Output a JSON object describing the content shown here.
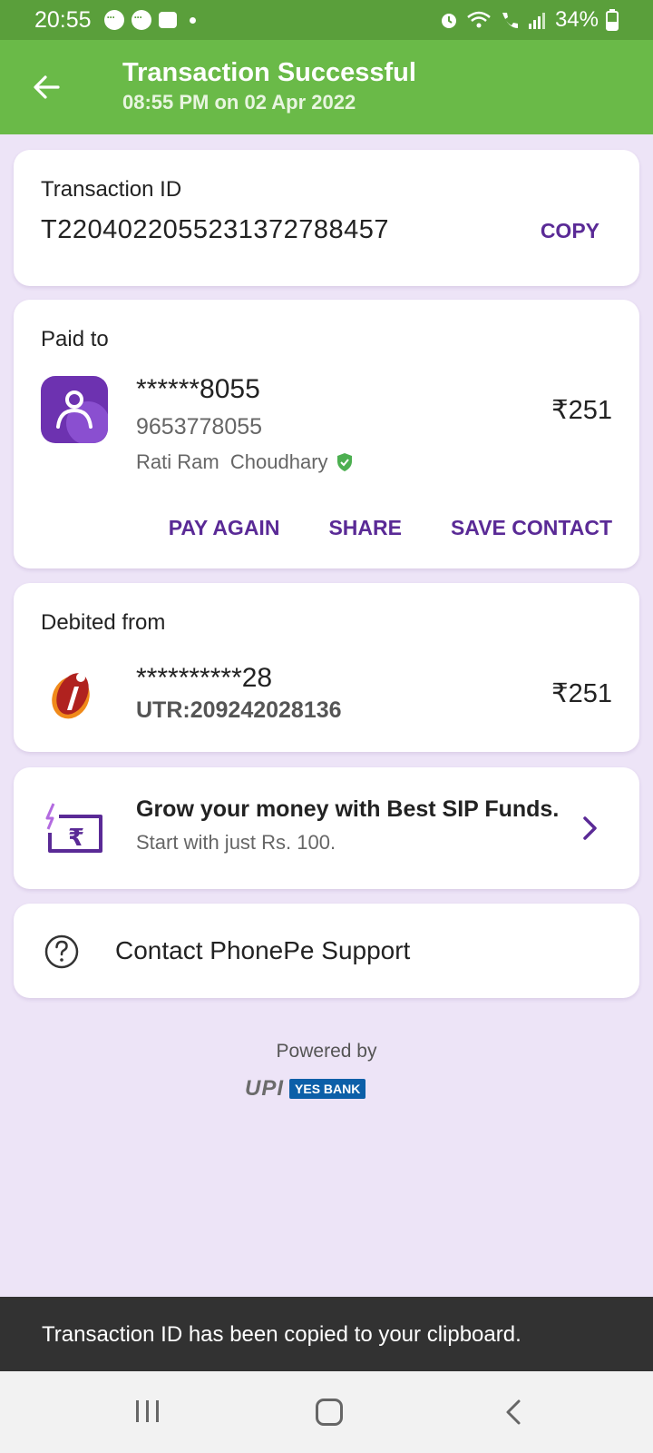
{
  "status_bar": {
    "time": "20:55",
    "battery": "34%",
    "icons": [
      "chat-bubble-icon",
      "chat-bubble-icon",
      "message-icon",
      "dot-icon",
      "alarm-icon",
      "wifi-call-icon",
      "call-icon",
      "signal-icon",
      "battery-icon"
    ]
  },
  "header": {
    "title": "Transaction Successful",
    "subtitle": "08:55 PM on 02 Apr 2022",
    "back_icon": "arrow-left-icon"
  },
  "transaction": {
    "label": "Transaction ID",
    "id": "T2204022055231372788457",
    "copy_label": "COPY"
  },
  "paid_to": {
    "label": "Paid to",
    "masked_number": "******8055",
    "phone": "9653778055",
    "name": "Rati Ram  Choudhary",
    "amount": "₹251",
    "actions": {
      "pay_again": "PAY AGAIN",
      "share": "SHARE",
      "save_contact": "SAVE CONTACT"
    }
  },
  "debited_from": {
    "label": "Debited from",
    "masked_account": "**********28",
    "utr": "UTR:209242028136",
    "amount": "₹251"
  },
  "promo": {
    "title": "Grow your money with Best SIP Funds.",
    "subtitle": "Start with just Rs. 100."
  },
  "support": {
    "label": "Contact PhonePe Support"
  },
  "footer": {
    "powered_by": "Powered by",
    "upi": "UPI",
    "bank": "YES BANK"
  },
  "toast": {
    "message": "Transaction ID has been copied to your clipboard."
  },
  "colors": {
    "status_bar": "#5a9f3b",
    "header": "#6aba48",
    "accent_purple": "#5a2a96",
    "background": "#ede4f7",
    "verified_green": "#4caf50"
  }
}
